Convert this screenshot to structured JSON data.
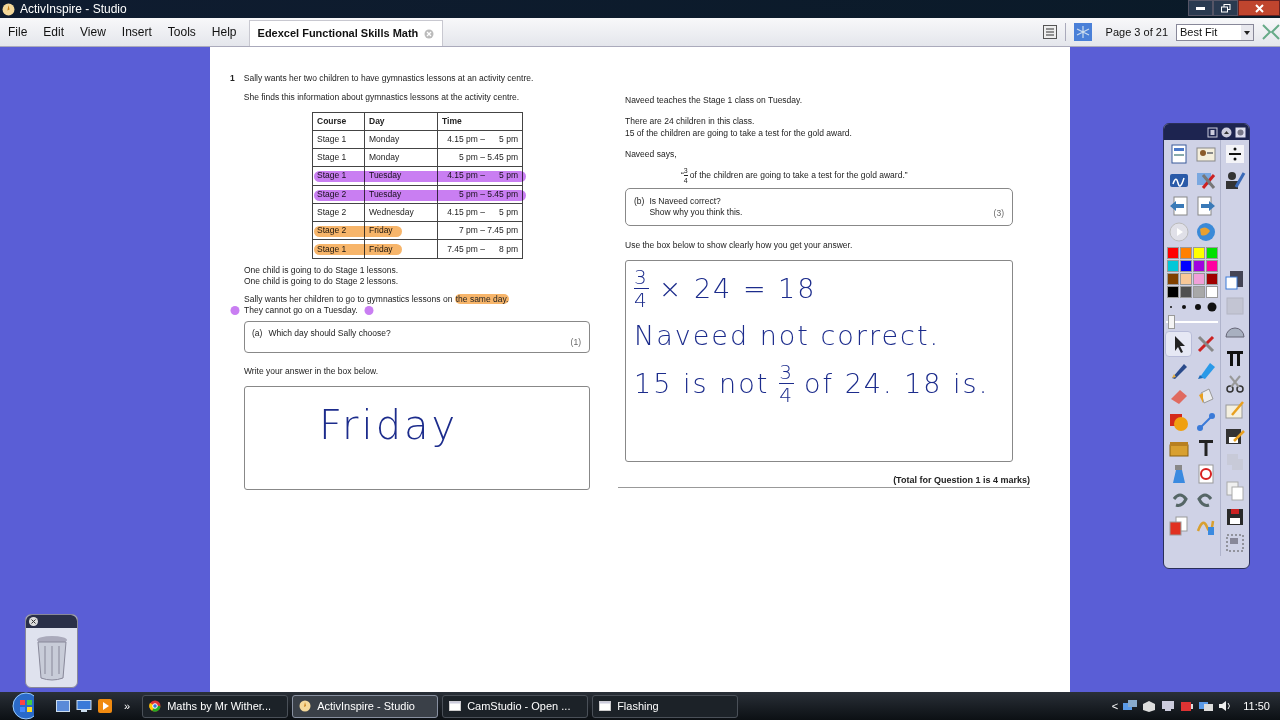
{
  "window": {
    "title": "ActivInspire - Studio"
  },
  "menu": [
    "File",
    "Edit",
    "View",
    "Insert",
    "Tools",
    "Help"
  ],
  "document_tab": {
    "label": "Edexcel Functional Skills Math"
  },
  "toolbar": {
    "page_indicator": "Page 3 of 21",
    "zoom": "Best Fit"
  },
  "question": {
    "number": "1",
    "intro": [
      "Sally wants her two children to have gymnastics lessons at an activity centre.",
      "She finds this information about gymnastics lessons at the activity centre."
    ],
    "table": {
      "columns": [
        "Course",
        "Day",
        "Time"
      ],
      "rows": [
        {
          "cells": [
            "Stage 1",
            "Monday",
            "4.15 pm –      5 pm"
          ],
          "kind": "plain"
        },
        {
          "cells": [
            "Stage 1",
            "Monday",
            "5 pm – 5.45 pm"
          ],
          "kind": "plain"
        },
        {
          "cells": [
            "Stage 1",
            "Tuesday",
            "4.15 pm –      5 pm"
          ],
          "color": "#c97ef2",
          "kind": "struck"
        },
        {
          "cells": [
            "Stage 2",
            "Tuesday",
            "5 pm – 5.45 pm"
          ],
          "color": "#c97ef2",
          "kind": "struck"
        },
        {
          "cells": [
            "Stage 2",
            "Wednesday",
            "4.15 pm –      5 pm"
          ],
          "kind": "plain"
        },
        {
          "cells": [
            "Stage 2",
            "Friday",
            "7 pm – 7.45 pm"
          ],
          "color": "#f7b56a",
          "kind": "highlighted"
        },
        {
          "cells": [
            "Stage 1",
            "Friday",
            "7.45 pm –      8 pm"
          ],
          "color": "#f7b56a",
          "kind": "highlighted"
        }
      ]
    },
    "notes": [
      "One child is going to do Stage 1 lessons.",
      "One child is going to do Stage 2 lessons."
    ],
    "condition": {
      "text": "Sally wants her children to go to gymnastics lessons on ",
      "marked_text": "the same day.",
      "color": "#f7b56a"
    },
    "restriction": "They cannot go on a Tuesday.",
    "part_a": {
      "label": "(a)",
      "prompt": "Which day should Sally choose?",
      "marks": "(1)"
    },
    "answer_instruction": "Write your answer in the box below.",
    "answer_a": "Friday",
    "context": [
      [
        "Naveed teaches the Stage 1 class on Tuesday."
      ],
      [
        "There are 24 children in this class.",
        "15 of the children are going to take a test for the gold award."
      ],
      [
        "Naveed says,"
      ]
    ],
    "quote": {
      "open": "“",
      "numerator": "3",
      "denominator": "4",
      "text": "of the children are going to take a test for the gold award.”"
    },
    "part_b": {
      "label": "(b)",
      "prompt": "Is Naveed correct?",
      "subprompt": "Show why you think this.",
      "marks": "(3)"
    },
    "working_instruction": "Use the box below to show clearly how you get your answer.",
    "working": [
      [
        {
          "kind": "fraction",
          "numerator": "3",
          "denominator": "4"
        },
        {
          "kind": "text",
          "text": "× 24 = 18"
        }
      ],
      [
        {
          "kind": "text",
          "text": "Naveed not correct."
        }
      ],
      [
        {
          "kind": "text",
          "text": "15 is not"
        },
        {
          "kind": "fraction",
          "numerator": "3",
          "denominator": "4"
        },
        {
          "kind": "text",
          "text": "of 24. 18 is."
        }
      ]
    ],
    "total": "(Total for Question 1 is 4 marks)"
  },
  "toolbox": {
    "left_top": [
      {
        "kind": "profiles",
        "selected": false,
        "disabled": false
      },
      {
        "kind": "resources",
        "selected": false,
        "disabled": false
      },
      {
        "kind": "signature",
        "selected": false,
        "disabled": false
      },
      {
        "kind": "design",
        "selected": false,
        "disabled": false
      },
      {
        "kind": "prevpage",
        "selected": false,
        "disabled": false
      },
      {
        "kind": "nextpage",
        "selected": false,
        "disabled": false
      },
      {
        "kind": "play",
        "selected": false,
        "disabled": false
      },
      {
        "kind": "globe",
        "selected": false,
        "disabled": false
      }
    ],
    "palette": [
      {
        "color": "#ff0000"
      },
      {
        "color": "#ff8000"
      },
      {
        "color": "#ffff00"
      },
      {
        "color": "#00e000"
      },
      {
        "color": "#00c8d8"
      },
      {
        "color": "#0000ff"
      },
      {
        "color": "#a000e0"
      },
      {
        "color": "#ff00a0"
      },
      {
        "color": "#804000"
      },
      {
        "color": "#f8c898"
      },
      {
        "color": "#f0a0d8"
      },
      {
        "color": "#a00000"
      },
      {
        "color": "#000000"
      },
      {
        "color": "#505050"
      },
      {
        "color": "#a8a8a8"
      },
      {
        "color": "#ffffff"
      }
    ],
    "width_slider": {
      "level": 0.05
    },
    "left_bottom": [
      {
        "kind": "pointer",
        "selected": true,
        "disabled": false
      },
      {
        "kind": "tools",
        "selected": false,
        "disabled": false
      },
      {
        "kind": "pen",
        "selected": false,
        "disabled": false
      },
      {
        "kind": "highlighter",
        "selected": false,
        "disabled": false
      },
      {
        "kind": "eraser",
        "selected": false,
        "disabled": false
      },
      {
        "kind": "fill",
        "selected": false,
        "disabled": false
      },
      {
        "kind": "shape",
        "selected": false,
        "disabled": false
      },
      {
        "kind": "connector",
        "selected": false,
        "disabled": false
      },
      {
        "kind": "chest",
        "selected": false,
        "disabled": false
      },
      {
        "kind": "text",
        "selected": false,
        "disabled": false
      },
      {
        "kind": "spray",
        "selected": false,
        "disabled": false
      },
      {
        "kind": "reset",
        "selected": false,
        "disabled": false
      },
      {
        "kind": "undo",
        "selected": false,
        "disabled": false
      },
      {
        "kind": "redo",
        "selected": false,
        "disabled": false
      },
      {
        "kind": "pages",
        "selected": false,
        "disabled": false
      },
      {
        "kind": "magic",
        "selected": false,
        "disabled": false
      }
    ],
    "right": [
      {
        "kind": "divide",
        "selected": false,
        "disabled": false
      },
      {
        "kind": "teacher",
        "selected": false,
        "disabled": false
      },
      {
        "kind": "paste",
        "selected": false,
        "disabled": false
      },
      {
        "kind": "shade",
        "selected": false,
        "disabled": true
      },
      {
        "kind": "protractor",
        "selected": false,
        "disabled": false
      },
      {
        "kind": "pi",
        "selected": false,
        "disabled": false
      },
      {
        "kind": "scissors",
        "selected": false,
        "disabled": false
      },
      {
        "kind": "edit",
        "selected": false,
        "disabled": false
      },
      {
        "kind": "savepen",
        "selected": false,
        "disabled": false
      },
      {
        "kind": "group",
        "selected": false,
        "disabled": true
      },
      {
        "kind": "copy",
        "selected": false,
        "disabled": false
      },
      {
        "kind": "save",
        "selected": false,
        "disabled": false
      },
      {
        "kind": "region",
        "selected": false,
        "disabled": false
      }
    ]
  },
  "taskbar": {
    "more": "»",
    "tasks": [
      {
        "label": "Maths by Mr Wither...",
        "kind": "browser",
        "selected": false
      },
      {
        "label": "ActivInspire - Studio",
        "kind": "app",
        "selected": true
      },
      {
        "label": "CamStudio - Open ...",
        "kind": "window",
        "selected": false
      },
      {
        "label": "Flashing",
        "kind": "window",
        "selected": false
      }
    ],
    "tray_toggle": "<",
    "clock": "11:50"
  }
}
